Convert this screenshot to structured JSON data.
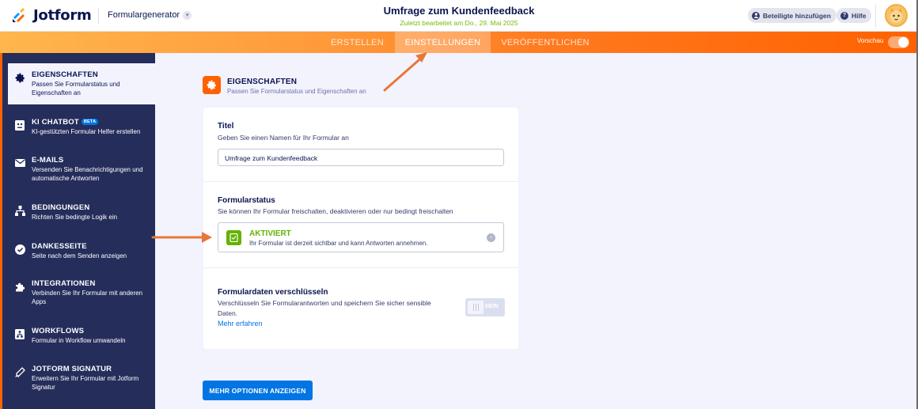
{
  "header": {
    "logo_text": "Jotform",
    "form_generator": "Formulargenerator",
    "form_title": "Umfrage zum Kundenfeedback",
    "saved_text": "Zuletzt bearbeitet am Do., 29. Mai 2025",
    "add_participants": "Beteiligte hinzufügen",
    "help": "Hilfe"
  },
  "nav": {
    "tabs": [
      {
        "label": "ERSTELLEN"
      },
      {
        "label": "EINSTELLUNGEN"
      },
      {
        "label": "VERÖFFENTLICHEN"
      }
    ],
    "preview_label": "Vorschau"
  },
  "sidebar": {
    "items": [
      {
        "title": "EIGENSCHAFTEN",
        "desc": "Passen Sie Formularstatus und Eigenschaften an"
      },
      {
        "title": "KI CHATBOT",
        "badge": "BETA",
        "desc": "KI-gestützten Formular Helfer erstellen"
      },
      {
        "title": "E-MAILS",
        "desc": "Versenden Sie Benachrichtigungen und automatische Antworten"
      },
      {
        "title": "BEDINGUNGEN",
        "desc": "Richten Sie bedingte Logik ein"
      },
      {
        "title": "DANKESSEITE",
        "desc": "Seite nach dem Senden anzeigen"
      },
      {
        "title": "INTEGRATIONEN",
        "desc": "Verbinden Sie Ihr Formular mit anderen Apps"
      },
      {
        "title": "WORKFLOWS",
        "desc": "Formular in Workflow umwandeln"
      },
      {
        "title": "JOTFORM SIGNATUR",
        "desc": "Erweitern Sie Ihr Formular mit Jotform Signatur"
      }
    ]
  },
  "main": {
    "section_title": "EIGENSCHAFTEN",
    "section_sub": "Passen Sie Formularstatus und Eigenschaften an",
    "title_label": "Titel",
    "title_hint": "Geben Sie einen Namen für Ihr Formular an",
    "title_value": "Umfrage zum Kundenfeedback",
    "status_label": "Formularstatus",
    "status_hint": "Sie können Ihr Formular freischalten, deaktivieren oder nur bedingt freischalten",
    "status_value": "AKTIVIERT",
    "status_desc": "Ihr Formular ist derzeit sichtbar und kann Antworten annehmen.",
    "encrypt_label": "Formulardaten verschlüsseln",
    "encrypt_hint": "Verschlüsseln Sie Formularantworten und speichern Sie sicher sensible Daten.",
    "encrypt_toggle": "NEIN",
    "learn_more": "Mehr erfahren",
    "more_options": "MEHR OPTIONEN ANZEIGEN"
  },
  "colors": {
    "brand_orange": "#ff6100",
    "sidebar_bg": "#252d5b",
    "active_green": "#64b200",
    "primary_blue": "#0075e3"
  }
}
